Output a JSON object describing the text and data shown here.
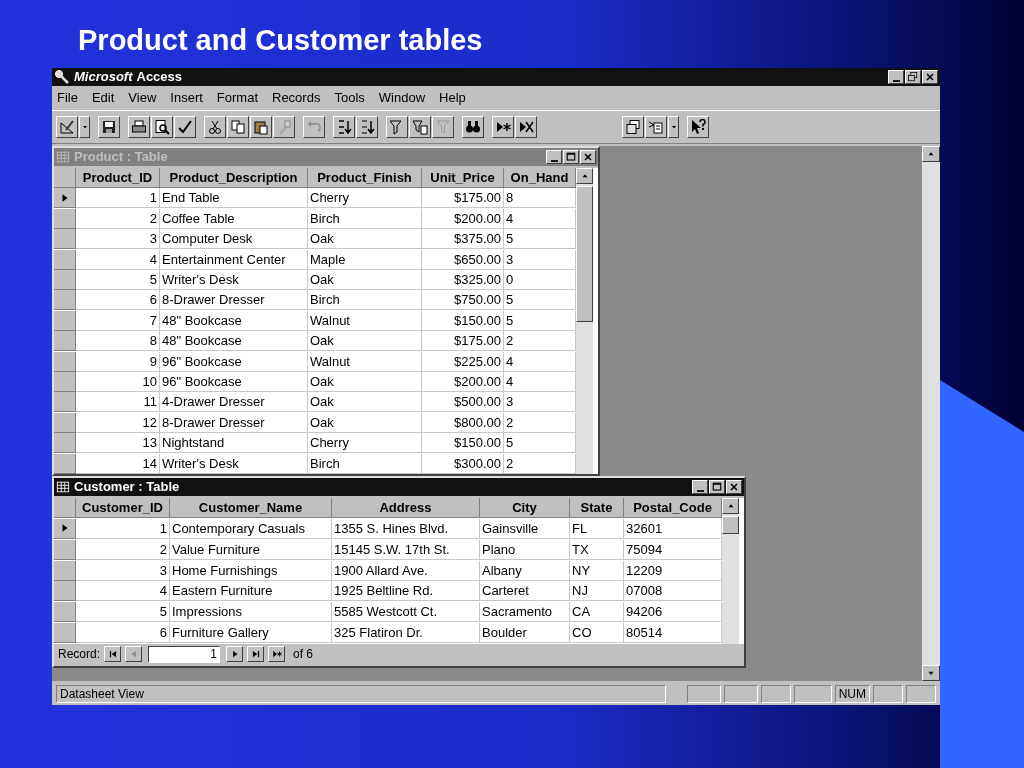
{
  "slide_title": "Product and Customer tables",
  "app": {
    "title_brand": "Microsoft",
    "title": "Access",
    "menu": [
      "File",
      "Edit",
      "View",
      "Insert",
      "Format",
      "Records",
      "Tools",
      "Window",
      "Help"
    ]
  },
  "product_window": {
    "title": "Product : Table",
    "columns": [
      "Product_ID",
      "Product_Description",
      "Product_Finish",
      "Unit_Price",
      "On_Hand"
    ],
    "rows": [
      {
        "selected": true,
        "cells": [
          "1",
          "End Table",
          "Cherry",
          "$175.00",
          "8"
        ]
      },
      {
        "selected": false,
        "cells": [
          "2",
          "Coffee Table",
          "Birch",
          "$200.00",
          "4"
        ]
      },
      {
        "selected": false,
        "cells": [
          "3",
          "Computer Desk",
          "Oak",
          "$375.00",
          "5"
        ]
      },
      {
        "selected": false,
        "cells": [
          "4",
          "Entertainment Center",
          "Maple",
          "$650.00",
          "3"
        ]
      },
      {
        "selected": false,
        "cells": [
          "5",
          "Writer's Desk",
          "Oak",
          "$325.00",
          "0"
        ]
      },
      {
        "selected": false,
        "cells": [
          "6",
          "8-Drawer Dresser",
          "Birch",
          "$750.00",
          "5"
        ]
      },
      {
        "selected": false,
        "cells": [
          "7",
          "48\" Bookcase",
          "Walnut",
          "$150.00",
          "5"
        ]
      },
      {
        "selected": false,
        "cells": [
          "8",
          "48\" Bookcase",
          "Oak",
          "$175.00",
          "2"
        ]
      },
      {
        "selected": false,
        "cells": [
          "9",
          "96\" Bookcase",
          "Walnut",
          "$225.00",
          "4"
        ]
      },
      {
        "selected": false,
        "cells": [
          "10",
          "96\" Bookcase",
          "Oak",
          "$200.00",
          "4"
        ]
      },
      {
        "selected": false,
        "cells": [
          "11",
          "4-Drawer Dresser",
          "Oak",
          "$500.00",
          "3"
        ]
      },
      {
        "selected": false,
        "cells": [
          "12",
          "8-Drawer Dresser",
          "Oak",
          "$800.00",
          "2"
        ]
      },
      {
        "selected": false,
        "cells": [
          "13",
          "Nightstand",
          "Cherry",
          "$150.00",
          "5"
        ]
      },
      {
        "selected": false,
        "cells": [
          "14",
          "Writer's Desk",
          "Birch",
          "$300.00",
          "2"
        ]
      }
    ]
  },
  "customer_window": {
    "title": "Customer : Table",
    "columns": [
      "Customer_ID",
      "Customer_Name",
      "Address",
      "City",
      "State",
      "Postal_Code"
    ],
    "rows": [
      {
        "selected": true,
        "cells": [
          "1",
          "Contemporary Casuals",
          "1355 S. Hines Blvd.",
          "Gainsville",
          "FL",
          "32601"
        ]
      },
      {
        "selected": false,
        "cells": [
          "2",
          "Value Furniture",
          "15145 S.W. 17th St.",
          "Plano",
          "TX",
          "75094"
        ]
      },
      {
        "selected": false,
        "cells": [
          "3",
          "Home Furnishings",
          "1900 Allard Ave.",
          "Albany",
          "NY",
          "12209"
        ]
      },
      {
        "selected": false,
        "cells": [
          "4",
          "Eastern Furniture",
          "1925 Beltline Rd.",
          "Carteret",
          "NJ",
          "07008"
        ]
      },
      {
        "selected": false,
        "cells": [
          "5",
          "Impressions",
          "5585 Westcott Ct.",
          "Sacramento",
          "CA",
          "94206"
        ]
      },
      {
        "selected": false,
        "cells": [
          "6",
          "Furniture Gallery",
          "325 Flatiron Dr.",
          "Boulder",
          "CO",
          "80514"
        ]
      }
    ],
    "record_nav": {
      "label": "Record:",
      "value": "1",
      "total": "of 6"
    }
  },
  "status_bar": {
    "text": "Datasheet View",
    "indicator": "NUM"
  }
}
